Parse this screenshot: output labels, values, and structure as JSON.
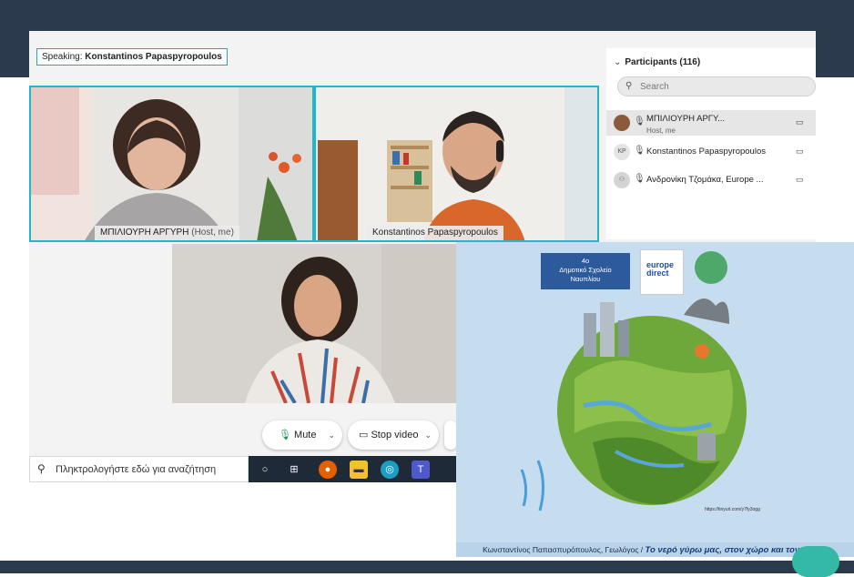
{
  "meeting": {
    "speaking_label": "Speaking:",
    "speaking_name": "Konstantinos Papaspyropoulos"
  },
  "tiles": [
    {
      "name": "ΜΠΙΛΙΟΥΡΗ ΑΡΓΥΡΗ",
      "suffix": "(Host, me)"
    },
    {
      "name": "Konstantinos Papaspyropoulos",
      "suffix": ""
    }
  ],
  "participants": {
    "title": "Participants (116)",
    "search_placeholder": "Search",
    "items": [
      {
        "initials": "",
        "name": "ΜΠΙΛΙΟΥΡΗ ΑΡΓΥ...",
        "subtitle": "Host, me"
      },
      {
        "initials": "KP",
        "name": "Konstantinos Papaspyropoulos",
        "subtitle": ""
      },
      {
        "initials": "",
        "name": "Ανδρονίκη Τζομάκα, Europe ...",
        "subtitle": ""
      }
    ]
  },
  "controls": {
    "mute_label": "Mute",
    "stop_video_label": "Stop video"
  },
  "taskbar": {
    "search_text": "Πληκτρολογήστε εδώ για αναζήτηση"
  },
  "slide": {
    "school_line1": "4ο",
    "school_line2": "Δημοτικό Σχολείο",
    "school_line3": "Ναυπλίου",
    "logo_text": "europe direct",
    "url": "https://tinyurl.com/y7fy3ogg",
    "caption_author": "Κωνσταντίνος Παπασπυρόπουλος, Γεωλόγος /",
    "caption_title": "Το νερό γύρω μας, στον χώρο και τον χρόνο"
  },
  "colors": {
    "frame": "#2b3a4d",
    "highlight": "#22b6c9",
    "accent_teal": "#35b9a7"
  }
}
